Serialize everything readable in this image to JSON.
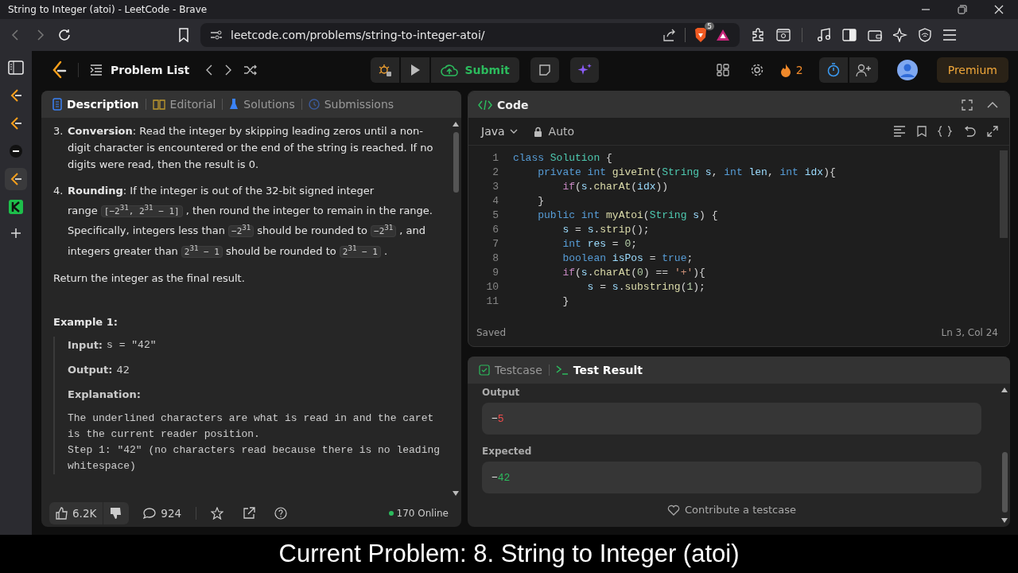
{
  "window": {
    "title": "String to Integer (atoi) - LeetCode - Brave"
  },
  "browser": {
    "url": "leetcode.com/problems/string-to-integer-atoi/",
    "shield_badge": "5"
  },
  "header": {
    "problem_list": "Problem List",
    "submit": "Submit",
    "streak": "2",
    "premium": "Premium"
  },
  "description": {
    "tabs": [
      {
        "label": "Description",
        "selected": true
      },
      {
        "label": "Editorial",
        "selected": false
      },
      {
        "label": "Solutions",
        "selected": false
      },
      {
        "label": "Submissions",
        "selected": false
      }
    ],
    "rules": [
      {
        "number": "3.",
        "segments": [
          {
            "kind": "text",
            "text": "**Conversion**: Read the integer by skipping leading zeros until a non-digit character is encountered or the end of the string is reached. If no digits were read, then the result is 0."
          }
        ]
      },
      {
        "number": "4.",
        "segments": [
          {
            "kind": "text",
            "text": "**Rounding**: If the integer is out of the 32-bit signed integer range"
          },
          {
            "kind": "code",
            "text": "[−2$^{31}$, 2$^{31}$ − 1]"
          },
          {
            "kind": "text",
            "text": ", then round the integer to remain in the range. Specifically, integers less than"
          },
          {
            "kind": "code",
            "text": "−2$^{31}$"
          },
          {
            "kind": "text",
            "text": "should be rounded to"
          },
          {
            "kind": "code",
            "text": "−2$^{31}$"
          },
          {
            "kind": "text",
            "text": ", and integers greater than"
          },
          {
            "kind": "code",
            "text": "2$^{31}$ − 1"
          },
          {
            "kind": "text",
            "text": "should be rounded to"
          },
          {
            "kind": "code",
            "text": "2$^{31}$ − 1"
          },
          {
            "kind": "text",
            "text": "."
          }
        ]
      }
    ],
    "return_text": "Return the integer as the final result.",
    "example": {
      "title": "Example 1:",
      "input_label": "Input:",
      "input_value": "s = \"42\"",
      "output_label": "Output:",
      "output_value": "42",
      "explanation_label": "Explanation:",
      "explanation": "The underlined characters are what is read in and the caret is the current reader position.\nStep 1: \"42\" (no characters read because there is no leading whitespace)"
    },
    "footer": {
      "likes": "6.2K",
      "comments": "924",
      "online": "170 Online"
    }
  },
  "code": {
    "title": "Code",
    "language": "Java",
    "mode": "Auto",
    "status": "Saved",
    "position": "Ln 3, Col 24",
    "lines": [
      {
        "number": "1",
        "tokens": [
          {
            "kind": "kw",
            "text": "class "
          },
          {
            "kind": "type",
            "text": "Solution"
          },
          {
            "kind": "plain",
            "text": " {"
          }
        ]
      },
      {
        "number": "2",
        "tokens": [
          {
            "kind": "kw",
            "text": "    private int "
          },
          {
            "kind": "fn",
            "text": "giveInt"
          },
          {
            "kind": "plain",
            "text": "("
          },
          {
            "kind": "type",
            "text": "String"
          },
          {
            "kind": "var",
            "text": " s"
          },
          {
            "kind": "plain",
            "text": ", "
          },
          {
            "kind": "kw",
            "text": "int "
          },
          {
            "kind": "var",
            "text": "len"
          },
          {
            "kind": "plain",
            "text": ", "
          },
          {
            "kind": "kw",
            "text": "int "
          },
          {
            "kind": "var",
            "text": "idx"
          },
          {
            "kind": "plain",
            "text": "){"
          }
        ]
      },
      {
        "number": "3",
        "tokens": [
          {
            "kind": "ctl",
            "text": "        if"
          },
          {
            "kind": "plain",
            "text": "("
          },
          {
            "kind": "var",
            "text": "s"
          },
          {
            "kind": "plain",
            "text": "."
          },
          {
            "kind": "fn",
            "text": "charAt"
          },
          {
            "kind": "plain",
            "text": "("
          },
          {
            "kind": "var",
            "text": "idx"
          },
          {
            "kind": "plain",
            "text": "))"
          }
        ]
      },
      {
        "number": "4",
        "tokens": [
          {
            "kind": "plain",
            "text": "    }"
          }
        ]
      },
      {
        "number": "5",
        "tokens": [
          {
            "kind": "kw",
            "text": "    public int "
          },
          {
            "kind": "fn",
            "text": "myAtoi"
          },
          {
            "kind": "plain",
            "text": "("
          },
          {
            "kind": "type",
            "text": "String"
          },
          {
            "kind": "var",
            "text": " s"
          },
          {
            "kind": "plain",
            "text": ") {"
          }
        ]
      },
      {
        "number": "6",
        "tokens": [
          {
            "kind": "var",
            "text": "        s"
          },
          {
            "kind": "plain",
            "text": " = "
          },
          {
            "kind": "var",
            "text": "s"
          },
          {
            "kind": "plain",
            "text": "."
          },
          {
            "kind": "fn",
            "text": "strip"
          },
          {
            "kind": "plain",
            "text": "();"
          }
        ]
      },
      {
        "number": "7",
        "tokens": [
          {
            "kind": "kw",
            "text": "        int "
          },
          {
            "kind": "var",
            "text": "res"
          },
          {
            "kind": "plain",
            "text": " = "
          },
          {
            "kind": "num",
            "text": "0"
          },
          {
            "kind": "plain",
            "text": ";"
          }
        ]
      },
      {
        "number": "8",
        "tokens": [
          {
            "kind": "kw",
            "text": "        boolean "
          },
          {
            "kind": "var",
            "text": "isPos"
          },
          {
            "kind": "plain",
            "text": " = "
          },
          {
            "kind": "kw",
            "text": "true"
          },
          {
            "kind": "plain",
            "text": ";"
          }
        ]
      },
      {
        "number": "9",
        "tokens": [
          {
            "kind": "ctl",
            "text": "        if"
          },
          {
            "kind": "plain",
            "text": "("
          },
          {
            "kind": "var",
            "text": "s"
          },
          {
            "kind": "plain",
            "text": "."
          },
          {
            "kind": "fn",
            "text": "charAt"
          },
          {
            "kind": "plain",
            "text": "("
          },
          {
            "kind": "num",
            "text": "0"
          },
          {
            "kind": "plain",
            "text": ") == "
          },
          {
            "kind": "str",
            "text": "'+'"
          },
          {
            "kind": "plain",
            "text": "){"
          }
        ]
      },
      {
        "number": "10",
        "tokens": [
          {
            "kind": "var",
            "text": "            s"
          },
          {
            "kind": "plain",
            "text": " = "
          },
          {
            "kind": "var",
            "text": "s"
          },
          {
            "kind": "plain",
            "text": "."
          },
          {
            "kind": "fn",
            "text": "substring"
          },
          {
            "kind": "plain",
            "text": "("
          },
          {
            "kind": "num",
            "text": "1"
          },
          {
            "kind": "plain",
            "text": ");"
          }
        ]
      },
      {
        "number": "11",
        "tokens": [
          {
            "kind": "plain",
            "text": "        }"
          }
        ]
      }
    ]
  },
  "test": {
    "tabs": [
      {
        "label": "Testcase",
        "selected": false
      },
      {
        "label": "Test Result",
        "selected": true
      }
    ],
    "fields": [
      {
        "label": "Output",
        "parts": [
          {
            "kind": "same",
            "text": "−"
          },
          {
            "kind": "removed",
            "text": "5"
          }
        ]
      },
      {
        "label": "Expected",
        "parts": [
          {
            "kind": "same",
            "text": "−"
          },
          {
            "kind": "added",
            "text": "42"
          }
        ]
      }
    ],
    "contribute": "Contribute a testcase"
  },
  "caption": "Current Problem: 8. String to Integer (atoi)"
}
